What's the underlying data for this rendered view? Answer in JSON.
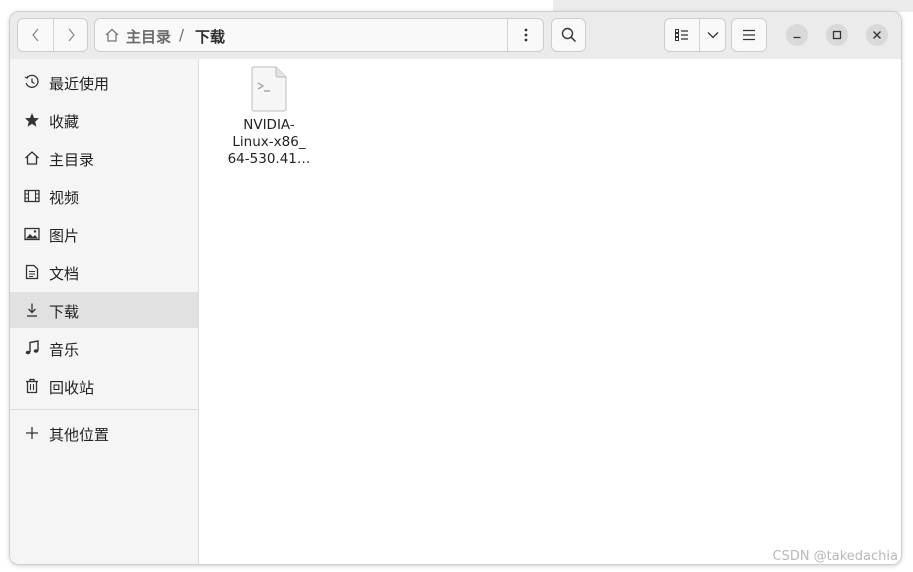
{
  "header": {
    "path_home": "主目录",
    "path_separator": "/",
    "path_current": "下载"
  },
  "sidebar": {
    "items": [
      {
        "label": "最近使用",
        "icon": "clock-icon"
      },
      {
        "label": "收藏",
        "icon": "star-icon"
      },
      {
        "label": "主目录",
        "icon": "home-icon"
      },
      {
        "label": "视频",
        "icon": "film-icon"
      },
      {
        "label": "图片",
        "icon": "image-icon"
      },
      {
        "label": "文档",
        "icon": "document-icon"
      },
      {
        "label": "下载",
        "icon": "download-icon",
        "active": true
      },
      {
        "label": "音乐",
        "icon": "music-icon"
      },
      {
        "label": "回收站",
        "icon": "trash-icon"
      }
    ],
    "other_locations": {
      "label": "其他位置",
      "icon": "plus-icon"
    }
  },
  "files": [
    {
      "name_lines": [
        "NVIDIA-",
        "Linux-x86_",
        "64-530.41…"
      ],
      "icon": "terminal-script-icon"
    }
  ],
  "watermark": "CSDN @takedachia",
  "colors": {
    "headerbar": "#ebebeb",
    "sidebar": "#f5f5f5",
    "active_item": "#e1e1e1"
  }
}
